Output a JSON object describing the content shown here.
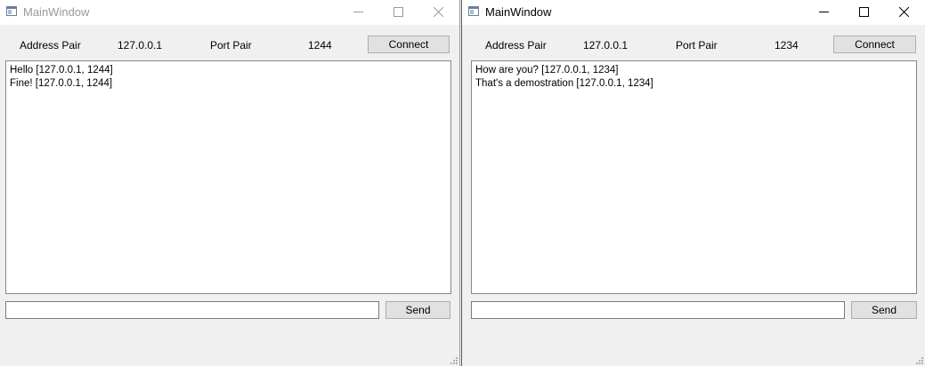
{
  "windows": [
    {
      "title": "MainWindow",
      "address_label": "Address Pair",
      "address_value": "127.0.0.1",
      "port_label": "Port Pair",
      "port_value": "1244",
      "connect_label": "Connect",
      "messages": [
        "Hello [127.0.0.1, 1244]",
        "Fine! [127.0.0.1, 1244]"
      ],
      "input_value": "",
      "send_label": "Send"
    },
    {
      "title": "MainWindow",
      "address_label": "Address Pair",
      "address_value": "127.0.0.1",
      "port_label": "Port Pair",
      "port_value": "1234",
      "connect_label": "Connect",
      "messages": [
        "How are you? [127.0.0.1, 1234]",
        "That's a demostration [127.0.0.1, 1234]"
      ],
      "input_value": "",
      "send_label": "Send"
    }
  ],
  "colors": {
    "inactive_title": "#9a9a9a",
    "active_title": "#000000",
    "window_bg": "#f0f0f0"
  }
}
